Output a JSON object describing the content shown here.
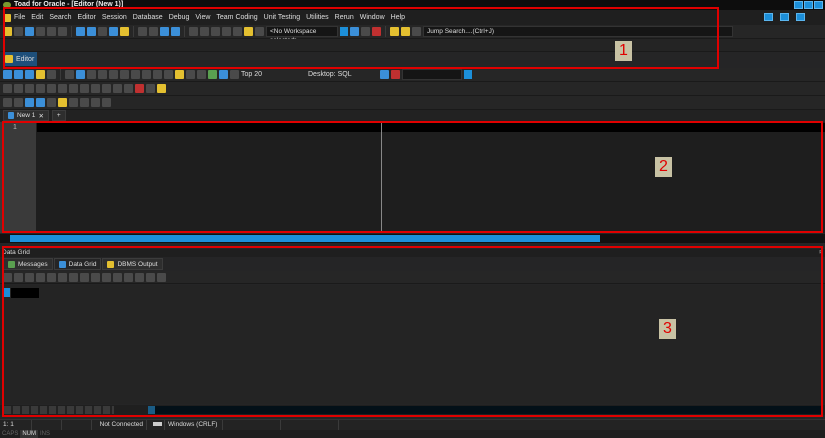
{
  "window": {
    "title": "Toad for Oracle - [Editor (New 1)]"
  },
  "menu": [
    "File",
    "Edit",
    "Search",
    "Editor",
    "Session",
    "Database",
    "Debug",
    "View",
    "Team Coding",
    "Unit Testing",
    "Utilities",
    "Rerun",
    "Window",
    "Help"
  ],
  "main_toolbar": {
    "workspace": "<No Workspace selected>",
    "jump_search": "Jump Search....(Ctrl+J)"
  },
  "editor_tab": "Editor",
  "editor_toolbar": {
    "rows_limit": "Top 20",
    "desktop_label": "Desktop:",
    "desktop_value": "SQL"
  },
  "doc_tabs": [
    {
      "label": "New 1"
    }
  ],
  "editor": {
    "line_numbers": [
      "1"
    ]
  },
  "bottom_panel": {
    "title": "Data Grid",
    "pin": "ᵖ",
    "tabs": [
      "Messages",
      "Data Grid",
      "DBMS Output"
    ]
  },
  "annotations": [
    "1",
    "2",
    "3"
  ],
  "status": {
    "position_line": "1:",
    "position_col": "1",
    "connection": "Not Connected",
    "line_ending": "Windows (CRLF)",
    "keys": [
      "CAPS",
      "NUM",
      "INS"
    ]
  }
}
